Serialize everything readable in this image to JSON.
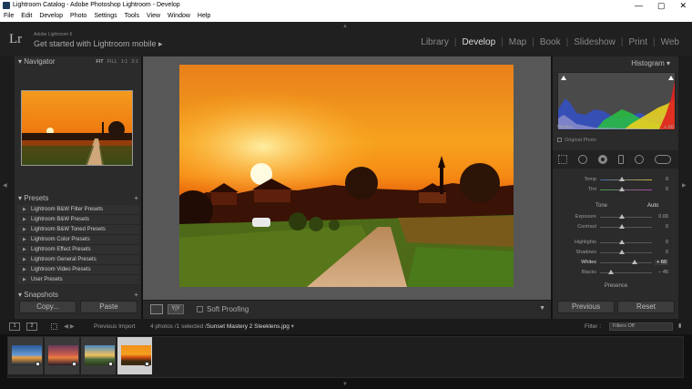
{
  "window": {
    "title": "Lightroom Catalog - Adobe Photoshop Lightroom - Develop",
    "controls": [
      "—",
      "▢",
      "✕"
    ]
  },
  "menu": [
    "File",
    "Edit",
    "Develop",
    "Photo",
    "Settings",
    "Tools",
    "View",
    "Window",
    "Help"
  ],
  "identity": {
    "logo": "Lr",
    "app_name": "Adobe Lightroom 6",
    "tagline": "Get started with Lightroom mobile ▸"
  },
  "modules": [
    "Library",
    "Develop",
    "Map",
    "Book",
    "Slideshow",
    "Print",
    "Web"
  ],
  "active_module": "Develop",
  "navigator": {
    "title": "Navigator",
    "zoom": [
      "FIT",
      "FILL",
      "1:1",
      "3:1"
    ]
  },
  "presets": {
    "title": "Presets",
    "items": [
      "Lightroom B&W Filter Presets",
      "Lightroom B&W Presets",
      "Lightroom B&W Toned Presets",
      "Lightroom Color Presets",
      "Lightroom Effect Presets",
      "Lightroom General Presets",
      "Lightroom Video Presets",
      "User Presets"
    ]
  },
  "snapshots": {
    "title": "Snapshots"
  },
  "left_buttons": {
    "copy": "Copy...",
    "paste": "Paste"
  },
  "toolbar": {
    "view_label": "Y|Y",
    "soft_proofing": "Soft Proofing"
  },
  "histogram": {
    "title": "Histogram",
    "readout_label": "Whites",
    "readout_value": "+ 60",
    "original_photo": "Original Photo"
  },
  "basic": {
    "temp": {
      "label": "Temp",
      "value": "0"
    },
    "tint": {
      "label": "Tint",
      "value": "0"
    },
    "tone_label": "Tone",
    "auto_label": "Auto",
    "exposure": {
      "label": "Exposure",
      "value": "0.00"
    },
    "contrast": {
      "label": "Contrast",
      "value": "0"
    },
    "highlights": {
      "label": "Highlights",
      "value": "0"
    },
    "shadows": {
      "label": "Shadows",
      "value": "0"
    },
    "whites": {
      "label": "Whites",
      "value": "+ 60"
    },
    "blacks": {
      "label": "Blacks",
      "value": "− 45"
    },
    "presence": "Presence"
  },
  "right_buttons": {
    "previous": "Previous",
    "reset": "Reset"
  },
  "filmstrip_bar": {
    "page1": "1",
    "page2": "2",
    "source": "Previous Import",
    "count": "4 photos /1 selected /",
    "filename": "Sunset Mastery 2 Sleeklens.jpg",
    "filter_label": "Filter :",
    "filter_value": "Filters Off"
  },
  "colors": {
    "accent": "#e07a10",
    "panel_bg": "#2b2b2b",
    "center_bg": "#575757"
  }
}
